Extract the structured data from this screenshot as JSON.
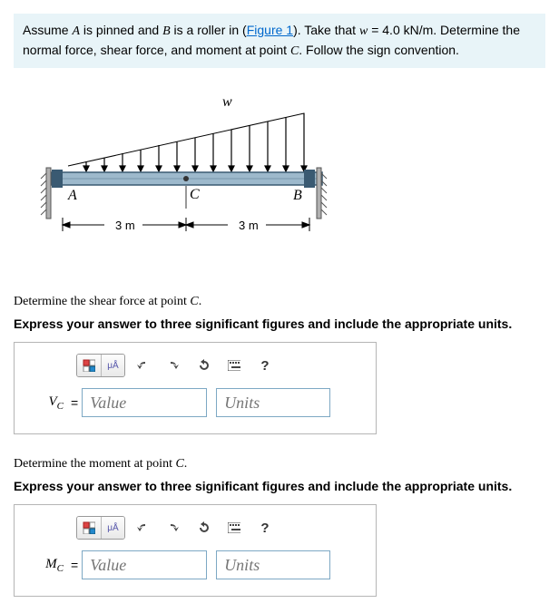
{
  "problem": {
    "text_parts": {
      "p1": "Assume ",
      "varA": "A",
      "p2": " is pinned and ",
      "varB": "B",
      "p3": " is a roller in (",
      "figlink": "Figure 1",
      "p4": "). Take that ",
      "varw": "w",
      "p5": " = 4.0 kN/m. Determine the normal force, shear force, and moment at point ",
      "varC": "C",
      "p6": ". Follow the sign convention."
    }
  },
  "figure": {
    "label_w": "w",
    "label_A": "A",
    "label_B": "B",
    "label_C": "C",
    "dim1": "3 m",
    "dim2": "3 m"
  },
  "parts": [
    {
      "id": "shear",
      "header_pre": "Determine the shear force at point ",
      "header_var": "C",
      "header_post": ".",
      "instruction": "Express your answer to three significant figures and include the appropriate units.",
      "var_letter": "V",
      "var_sub": "C",
      "value_placeholder": "Value",
      "units_placeholder": "Units"
    },
    {
      "id": "moment",
      "header_pre": "Determine the moment at point ",
      "header_var": "C",
      "header_post": ".",
      "instruction": "Express your answer to three significant figures and include the appropriate units.",
      "var_letter": "M",
      "var_sub": "C",
      "value_placeholder": "Value",
      "units_placeholder": "Units"
    }
  ],
  "toolbar": {
    "ua_label": "μÅ",
    "help": "?"
  }
}
